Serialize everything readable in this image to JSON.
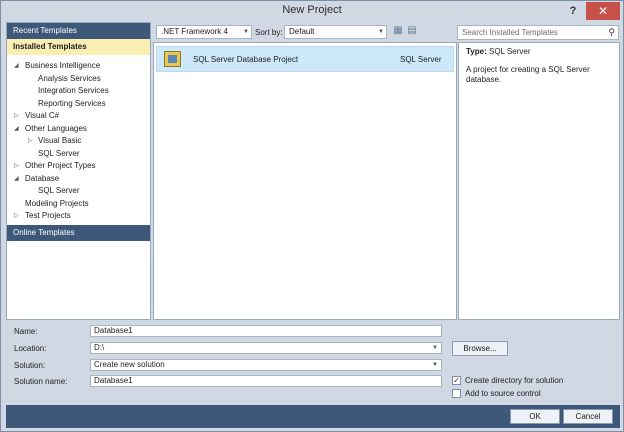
{
  "window": {
    "title": "New Project",
    "help_glyph": "?",
    "close_glyph": "✕"
  },
  "sidebar": {
    "recent": "Recent Templates",
    "installed": "Installed Templates",
    "online": "Online Templates",
    "tree": [
      {
        "label": "Business Intelligence",
        "arrow": "◢"
      },
      {
        "label": "Analysis Services",
        "arrow": ""
      },
      {
        "label": "Integration Services",
        "arrow": ""
      },
      {
        "label": "Reporting Services",
        "arrow": ""
      },
      {
        "label": "Visual C#",
        "arrow": "▷"
      },
      {
        "label": "Other Languages",
        "arrow": "◢"
      },
      {
        "label": "Visual Basic",
        "arrow": "▷"
      },
      {
        "label": "SQL Server",
        "arrow": ""
      },
      {
        "label": "Other Project Types",
        "arrow": "▷"
      },
      {
        "label": "Database",
        "arrow": "◢"
      },
      {
        "label": "SQL Server",
        "arrow": ""
      },
      {
        "label": "Modeling Projects",
        "arrow": ""
      },
      {
        "label": "Test Projects",
        "arrow": "▷"
      }
    ]
  },
  "toolbar": {
    "framework": ".NET Framework 4",
    "sort_label": "Sort by:",
    "sort_value": "Default",
    "search_placeholder": "Search Installed Templates"
  },
  "templates": [
    {
      "name": "SQL Server Database Project",
      "language": "SQL Server"
    }
  ],
  "details": {
    "type_label": "Type:",
    "type_value": "SQL Server",
    "description": "A project for creating a SQL Server database."
  },
  "form": {
    "name_label": "Name:",
    "name_value": "Database1",
    "location_label": "Location:",
    "location_value": "D:\\",
    "solution_label": "Solution:",
    "solution_value": "Create new solution",
    "solution_name_label": "Solution name:",
    "solution_name_value": "Database1",
    "browse_label": "Browse...",
    "create_dir_label": "Create directory for solution",
    "create_dir_checked": true,
    "source_control_label": "Add to source control",
    "source_control_checked": false
  },
  "buttons": {
    "ok": "OK",
    "cancel": "Cancel"
  }
}
